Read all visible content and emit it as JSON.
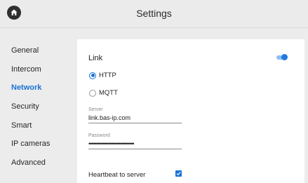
{
  "header": {
    "title": "Settings",
    "home_icon": "home-icon"
  },
  "sidebar": {
    "items": [
      {
        "label": "General"
      },
      {
        "label": "Intercom"
      },
      {
        "label": "Network"
      },
      {
        "label": "Security"
      },
      {
        "label": "Smart"
      },
      {
        "label": "IP cameras"
      },
      {
        "label": "Advanced"
      }
    ],
    "active": "Network"
  },
  "panel": {
    "link_label": "Link",
    "link_enabled": true,
    "protocols": [
      {
        "label": "HTTP",
        "selected": true
      },
      {
        "label": "MQTT",
        "selected": false
      }
    ],
    "server": {
      "caption": "Server",
      "value": "link.bas-ip.com"
    },
    "password": {
      "caption": "Password",
      "value": "••••••••••••••••••••••••••••••"
    },
    "heartbeat": {
      "label": "Heartbeat to server",
      "checked": true
    }
  },
  "colors": {
    "accent": "#1a73d6",
    "background": "#ececec",
    "panel": "#ffffff"
  }
}
